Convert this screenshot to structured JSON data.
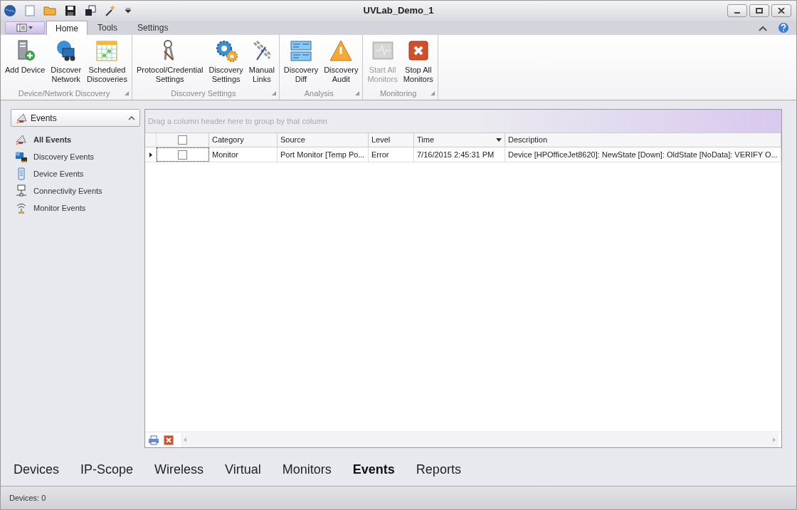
{
  "window": {
    "title": "UVLab_Demo_1"
  },
  "ribbon_tabs": [
    {
      "label": "Home",
      "selected": true
    },
    {
      "label": "Tools",
      "selected": false
    },
    {
      "label": "Settings",
      "selected": false
    }
  ],
  "ribbon_groups": [
    {
      "title": "Device/Network Discovery",
      "buttons": [
        {
          "label": "Add Device",
          "disabled": false
        },
        {
          "label": "Discover\nNetwork",
          "disabled": false
        },
        {
          "label": "Scheduled\nDiscoveries",
          "disabled": false
        }
      ]
    },
    {
      "title": "Discovery Settings",
      "buttons": [
        {
          "label": "Protocol/Credential\nSettings",
          "disabled": false
        },
        {
          "label": "Discovery\nSettings",
          "disabled": false
        },
        {
          "label": "Manual\nLinks",
          "disabled": false
        }
      ]
    },
    {
      "title": "Analysis",
      "buttons": [
        {
          "label": "Discovery\nDiff",
          "disabled": false
        },
        {
          "label": "Discovery\nAudit",
          "disabled": false
        }
      ]
    },
    {
      "title": "Monitoring",
      "buttons": [
        {
          "label": "Start All\nMonitors",
          "disabled": true
        },
        {
          "label": "Stop All\nMonitors",
          "disabled": false
        }
      ]
    }
  ],
  "sidebar": {
    "header": "Events",
    "items": [
      {
        "label": "All Events",
        "selected": true
      },
      {
        "label": "Discovery Events",
        "selected": false
      },
      {
        "label": "Device Events",
        "selected": false
      },
      {
        "label": "Connectivity Events",
        "selected": false
      },
      {
        "label": "Monitor Events",
        "selected": false
      }
    ]
  },
  "grid": {
    "group_panel_hint": "Drag a column header here to group by that column",
    "header_checked": false,
    "columns": [
      {
        "label": "Category",
        "sorted": false
      },
      {
        "label": "Source",
        "sorted": false
      },
      {
        "label": "Level",
        "sorted": false
      },
      {
        "label": "Time",
        "sorted": true
      },
      {
        "label": "Description",
        "sorted": false
      }
    ],
    "rows": [
      {
        "checked": false,
        "selected": true,
        "cells": [
          "Monitor",
          "Port Monitor [Temp Po...",
          "Error",
          "7/16/2015 2:45:31 PM",
          "Device [HPOfficeJet8620]: NewState [Down]: OldState [NoData]: VERIFY O..."
        ]
      }
    ]
  },
  "nav_tabs": [
    {
      "label": "Devices",
      "selected": false
    },
    {
      "label": "IP-Scope",
      "selected": false
    },
    {
      "label": "Wireless",
      "selected": false
    },
    {
      "label": "Virtual",
      "selected": false
    },
    {
      "label": "Monitors",
      "selected": false
    },
    {
      "label": "Events",
      "selected": true
    },
    {
      "label": "Reports",
      "selected": false
    }
  ],
  "status_bar": {
    "text": "Devices: 0"
  }
}
